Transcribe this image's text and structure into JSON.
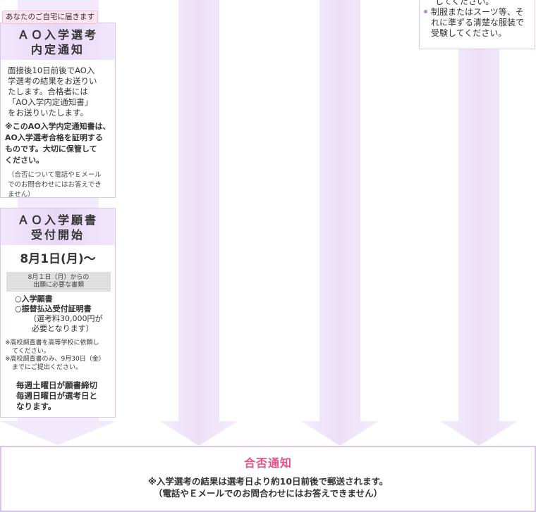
{
  "ao_notice": {
    "tag": "あなたのご自宅に届きます",
    "title_line1": "ＡＯ入学選考",
    "title_line2": "内定通知",
    "body_lines": [
      "面接後10日前後でAO入",
      "学選考の結果をお送りい",
      "たします。合格者には",
      "「AO入学内定通知書」",
      "をお送りいたします。"
    ],
    "bold_lines": [
      "※このAO入学内定通知書は、",
      "AO入学選考合格を証明する",
      "ものです。大切に保管して",
      "ください。"
    ],
    "note_lines": [
      "（合否について電話やＥメール",
      "でのお問合わせにはお答えでき",
      "ません）"
    ]
  },
  "ao_application": {
    "title_line1": "ＡＯ入学願書",
    "title_line2": "受付開始",
    "date": "8月1日(月)～",
    "docs_heading_line1": "8月１日（月）からの",
    "docs_heading_line2": "出願に必要な書類",
    "doc1": "○入学願書",
    "doc2": "○振替払込受付証明書",
    "fee_line1": "（選考料30,000円が",
    "fee_line2": "必要となります）",
    "note1_line1": "※高校調査書を高等学校に依頼し",
    "note1_line2": "てください。",
    "note2_line1": "※高校調査書のみ、9月30日（金）",
    "note2_line2": "までにご提出ください。",
    "deadline_line1": "毎週土曜日が願書締切",
    "deadline_line2": "毎週日曜日が選考日と",
    "deadline_line3": "なります。"
  },
  "top_right": {
    "line0": "してください。",
    "bullet_line1": "制服またはスーツ等、そ",
    "bullet_line2": "れに準ずる清楚な服装で",
    "bullet_line3": "受験してください。"
  },
  "result": {
    "title": "合否通知",
    "line1": "※入学選考の結果は選考日より約10日前後で郵送されます。",
    "line2": "（電話やＥメールでのお問合わせにはお答えできません）"
  },
  "colors": {
    "arrow_fill": "#efe4f8",
    "border": "#d9c6ea",
    "accent_pink": "#e9528a"
  }
}
